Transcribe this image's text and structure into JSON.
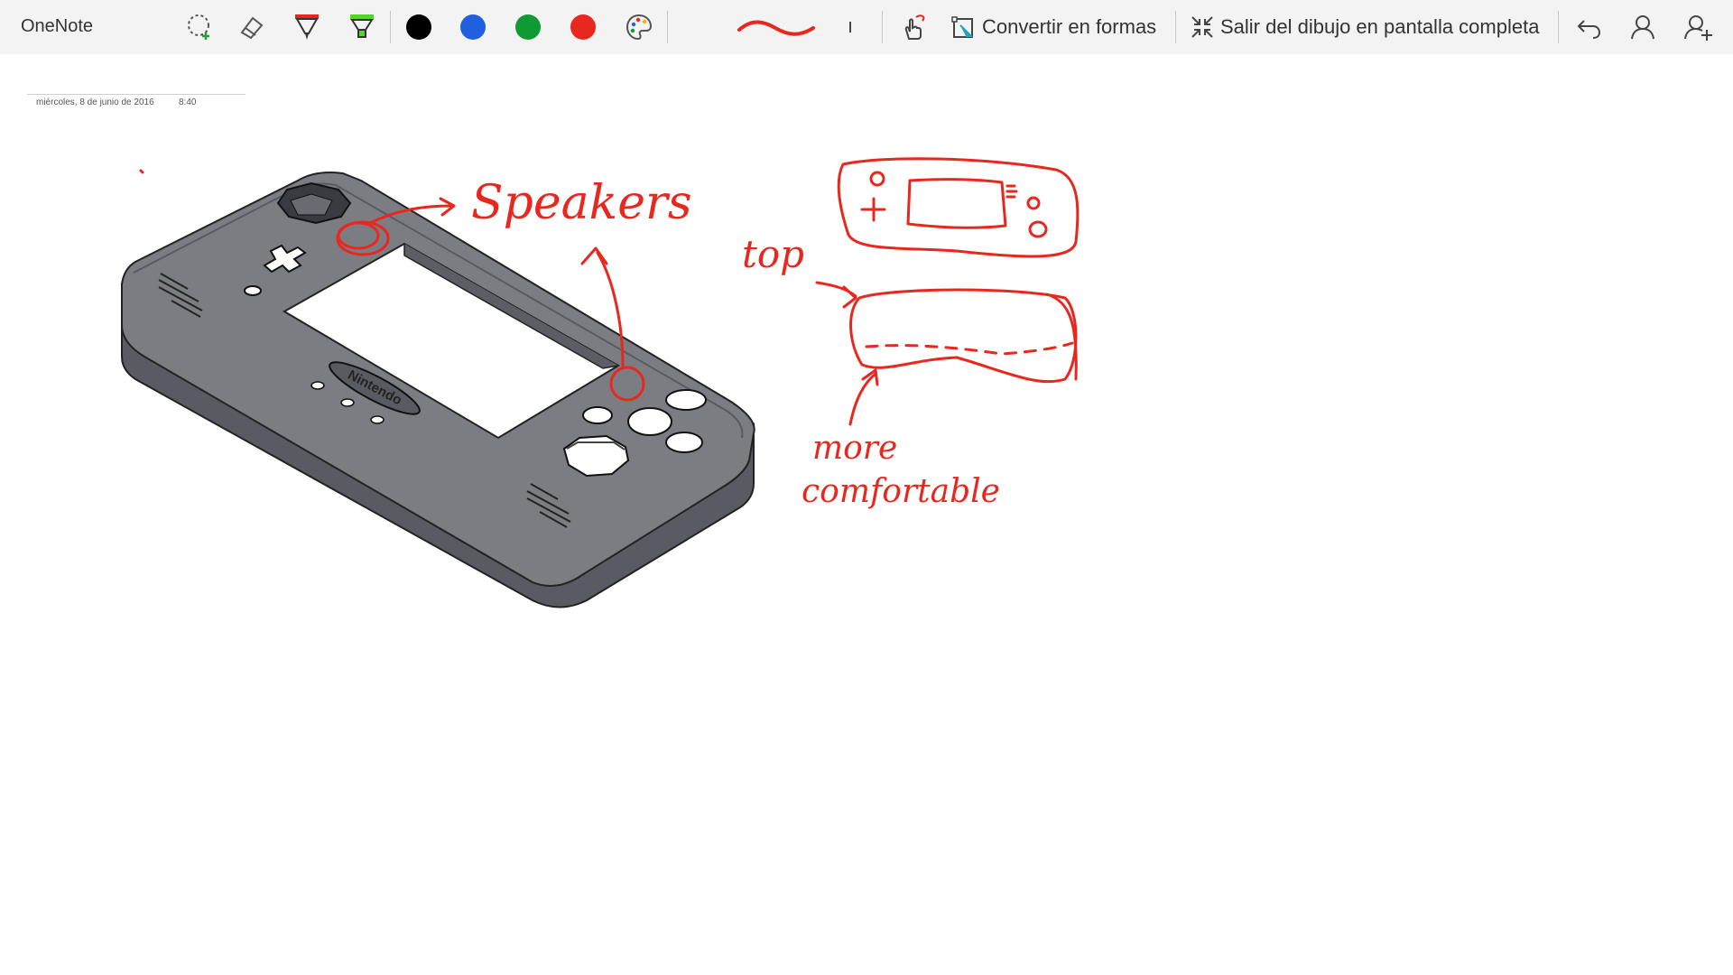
{
  "app": {
    "title": "OneNote"
  },
  "toolbar": {
    "lasso_icon": "lasso-select-icon",
    "eraser_icon": "eraser-icon",
    "pen_icon": "red-pen-icon",
    "highlighter_icon": "highlighter-icon",
    "colors": [
      "#000000",
      "#1f5fe0",
      "#109a33",
      "#e8281e"
    ],
    "palette_icon": "color-palette-icon",
    "thickness_icon": "stroke-thickness-icon",
    "touch_draw_icon": "touch-draw-icon",
    "convert_label": "Convertir en formas",
    "exit_label": "Salir del dibujo en pantalla completa",
    "undo_icon": "undo-icon",
    "user_icon": "user-icon",
    "add_user_icon": "add-user-icon"
  },
  "page": {
    "date": "miércoles, 8 de junio de 2016",
    "time": "8:40"
  },
  "ink": {
    "color": "#e8281e",
    "label_speakers": "Speakers",
    "label_top": "top",
    "label_more": "more",
    "label_comfortable": "comfortable"
  },
  "model": {
    "logo_text": "Nintendo"
  }
}
